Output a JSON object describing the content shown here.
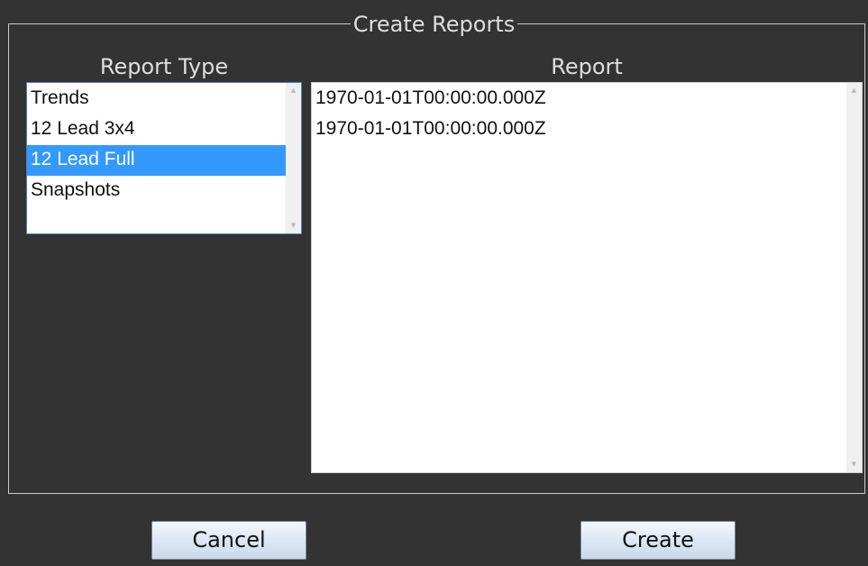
{
  "dialog": {
    "title": "Create Reports"
  },
  "report_type": {
    "header": "Report Type",
    "items": [
      {
        "label": "Trends",
        "selected": false
      },
      {
        "label": "12 Lead 3x4",
        "selected": false
      },
      {
        "label": "12 Lead Full",
        "selected": true
      },
      {
        "label": "Snapshots",
        "selected": false
      }
    ]
  },
  "report": {
    "header": "Report",
    "items": [
      {
        "label": "1970-01-01T00:00:00.000Z"
      },
      {
        "label": "1970-01-01T00:00:00.000Z"
      }
    ]
  },
  "icons": {
    "scroll_up": "scroll-up-arrow-icon",
    "scroll_down": "scroll-down-arrow-icon"
  },
  "buttons": {
    "cancel_label": "Cancel",
    "create_label": "Create"
  },
  "colors": {
    "background": "#333333",
    "selection": "#3399ff",
    "focus_border": "#4a7fc7"
  }
}
